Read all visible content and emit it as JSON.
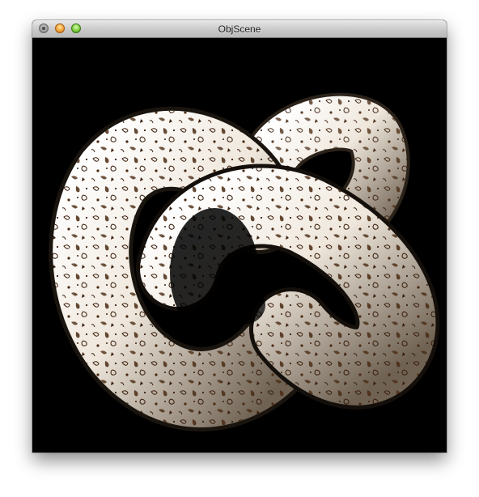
{
  "window": {
    "title": "ObjScene"
  },
  "controls": {
    "close": "close-icon",
    "minimize": "minimize-icon",
    "zoom": "zoom-icon"
  },
  "scene": {
    "background_color": "#000000",
    "surface_base_color": "#f2ebe1",
    "surface_spot_color": "#4a2a12"
  }
}
